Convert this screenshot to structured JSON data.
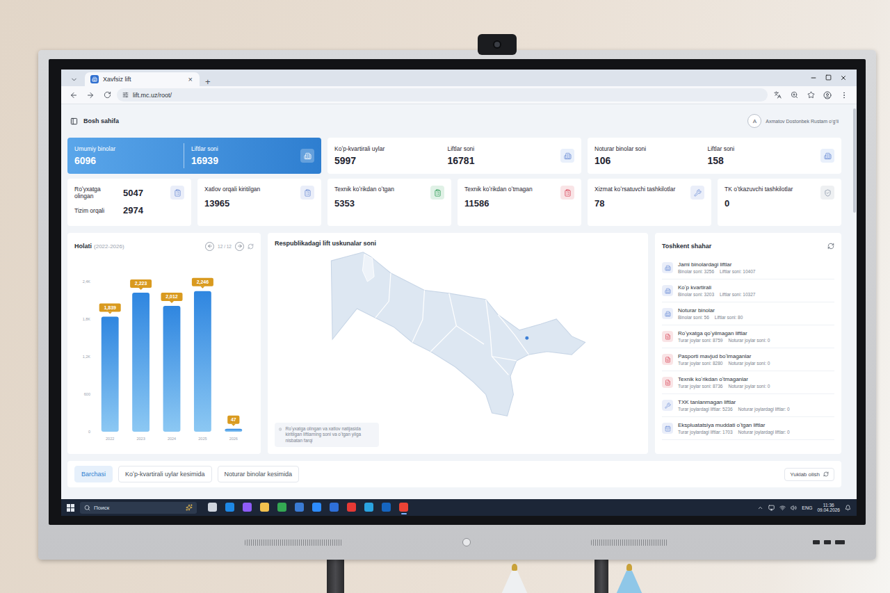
{
  "browser": {
    "tab_title": "Xavfsiz lift",
    "tab_close": "×",
    "new_tab": "+",
    "url": "lift.mc.uz/root/"
  },
  "header": {
    "title": "Bosh sahifa",
    "avatar": "A",
    "user": "Axmatov Dostonbek Rustam o‘g‘li"
  },
  "summary_cards": [
    {
      "highlighted": true,
      "kind": "building",
      "items": [
        {
          "label": "Umumiy binolar",
          "value": "6096"
        },
        {
          "label": "Liftlar soni",
          "value": "16939"
        }
      ]
    },
    {
      "highlighted": false,
      "kind": "building",
      "items": [
        {
          "label": "Koʻp-kvartirali uylar",
          "value": "5997"
        },
        {
          "label": "Liftlar soni",
          "value": "16781"
        }
      ]
    },
    {
      "highlighted": false,
      "kind": "building",
      "items": [
        {
          "label": "Noturar binolar soni",
          "value": "106"
        },
        {
          "label": "Liftlar soni",
          "value": "158"
        }
      ]
    }
  ],
  "stat_cards": [
    {
      "kind": "clipboard",
      "color": "#6f8fd6",
      "label": "Roʻyxatga olingan",
      "value": "5047",
      "sub_label": "Tizim orqali",
      "sub_value": "2974"
    },
    {
      "kind": "clipboard",
      "color": "#6f8fd6",
      "label": "Xatlov orqali kiritilgan",
      "value": "13965"
    },
    {
      "kind": "clipboard",
      "color": "#2f9e57",
      "label": "Texnik koʻrikdan oʻtgan",
      "value": "5353"
    },
    {
      "kind": "clipboard",
      "color": "#d9475a",
      "label": "Texnik koʻrikdan oʻtmagan",
      "value": "11586"
    },
    {
      "kind": "tool",
      "color": "#6f8fd6",
      "label": "Xizmat koʻrsatuvchi tashkilotlar",
      "value": "78"
    },
    {
      "kind": "shield",
      "color": "#8d99ab",
      "label": "TK oʻtkazuvchi tashkilotlar",
      "value": "0"
    }
  ],
  "chart": {
    "title": "Holati",
    "period": "(2022-2026)",
    "pager": "12 / 12",
    "categories": [
      "2022",
      "2023",
      "2024",
      "2025",
      "2026"
    ],
    "values": [
      1839,
      2223,
      2012,
      2246,
      47
    ],
    "value_labels": [
      "1,839",
      "2,223",
      "2,012",
      "2,246",
      "47"
    ],
    "ticks": [
      {
        "label": "2,4K",
        "value": 2400
      },
      {
        "label": "1,8K",
        "value": 1800
      },
      {
        "label": "1,2K",
        "value": 1200
      },
      {
        "label": "600",
        "value": 600
      },
      {
        "label": "0",
        "value": 0
      }
    ]
  },
  "map": {
    "title": "Respublikadagi lift uskunalar soni",
    "note": "Roʻyxatga olingan va xatlov natijasida kiritilgan liftlarning soni va oʻtgan yilga nisbatan farqi"
  },
  "region_panel": {
    "title": "Toshkent shahar",
    "items": [
      {
        "kind": "building",
        "color": "#6f8fd6",
        "title": "Jami binolardagi liftlar",
        "details": [
          "Binolar soni: 3256",
          "Liftlar soni: 10407"
        ]
      },
      {
        "kind": "building",
        "color": "#6f8fd6",
        "title": "Koʻp kvartirali",
        "details": [
          "Binolar soni: 3203",
          "Liftlar soni: 10327"
        ]
      },
      {
        "kind": "building",
        "color": "#6f8fd6",
        "title": "Noturar binolar",
        "details": [
          "Binolar soni: 56",
          "Liftlar soni: 80"
        ]
      },
      {
        "kind": "document",
        "color": "#d9475a",
        "title": "Roʻyxatga qoʻyilmagan liftlar",
        "details": [
          "Turar joylar soni: 8759",
          "Noturar joylar soni: 0"
        ]
      },
      {
        "kind": "document",
        "color": "#d9475a",
        "title": "Pasporti mavjud boʻlmaganlar",
        "details": [
          "Turar joylar soni: 8280",
          "Noturar joylar soni: 0"
        ]
      },
      {
        "kind": "document",
        "color": "#d9475a",
        "title": "Texnik koʻrikdan oʻtmaganlar",
        "details": [
          "Turar joylar soni: 8736",
          "Noturar joylar soni: 0"
        ]
      },
      {
        "kind": "tool",
        "color": "#6f8fd6",
        "title": "TXK tanlanmagan liftlar",
        "details": [
          "Turar joylardagi liftlar: 5236",
          "Noturar joylardagi liftlar: 0"
        ]
      },
      {
        "kind": "calendar",
        "color": "#6f8fd6",
        "title": "Ekspluatatsiya muddati oʻtgan liftlar",
        "details": [
          "Turar joylardagi liftlar: 1703",
          "Noturar joylardagi liftlar: 0"
        ]
      }
    ]
  },
  "bottom_tabs": [
    {
      "label": "Barchasi",
      "selected": true
    },
    {
      "label": "Koʻp-kvartirali uylar kesimida",
      "selected": false
    },
    {
      "label": "Noturar binolar kesimida",
      "selected": false
    }
  ],
  "download": "Yuklab olish",
  "taskbar": {
    "search_placeholder": "Поиск",
    "language": "ENG",
    "time": "11:36",
    "date": "09.04.2026",
    "apps": [
      {
        "color": "#cfd5de",
        "selected": false
      },
      {
        "color": "#1e88e5",
        "selected": false
      },
      {
        "color": "#8e5cf7",
        "selected": false
      },
      {
        "color": "#f2c14e",
        "selected": false
      },
      {
        "color": "#34a853",
        "selected": false
      },
      {
        "color": "#3a7bd5",
        "selected": false
      },
      {
        "color": "#2d8cff",
        "selected": false
      },
      {
        "color": "#2e6fd8",
        "selected": false
      },
      {
        "color": "#e53935",
        "selected": false
      },
      {
        "color": "#2aa3e0",
        "selected": false
      },
      {
        "color": "#1565c0",
        "selected": false
      },
      {
        "color": "#ea4335",
        "selected": true
      }
    ]
  }
}
